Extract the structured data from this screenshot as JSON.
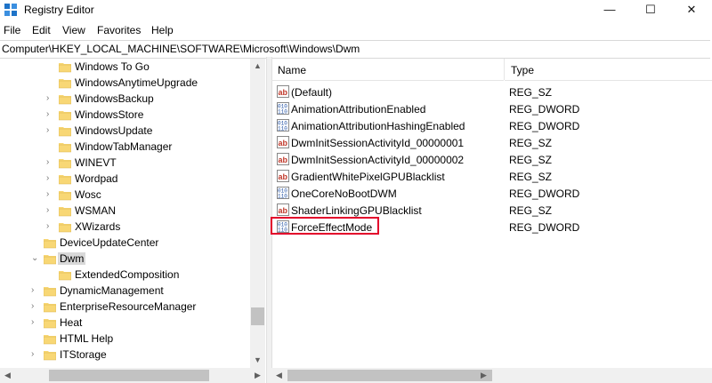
{
  "window": {
    "title": "Registry Editor",
    "minimize_glyph": "—",
    "maximize_glyph": "☐",
    "close_glyph": "✕"
  },
  "menu": [
    "File",
    "Edit",
    "View",
    "Favorites",
    "Help"
  ],
  "address": "Computer\\HKEY_LOCAL_MACHINE\\SOFTWARE\\Microsoft\\Windows\\Dwm",
  "tree": [
    {
      "label": "Windows To Go",
      "expander": false
    },
    {
      "label": "WindowsAnytimeUpgrade",
      "expander": false
    },
    {
      "label": "WindowsBackup",
      "expander": true
    },
    {
      "label": "WindowsStore",
      "expander": true
    },
    {
      "label": "WindowsUpdate",
      "expander": true
    },
    {
      "label": "WindowTabManager",
      "expander": false
    },
    {
      "label": "WINEVT",
      "expander": true
    },
    {
      "label": "Wordpad",
      "expander": true
    },
    {
      "label": "Wosc",
      "expander": true
    },
    {
      "label": "WSMAN",
      "expander": true
    },
    {
      "label": "XWizards",
      "expander": true
    },
    {
      "label": "DeviceUpdateCenter",
      "expander": false
    },
    {
      "label": "Dwm",
      "expander": true,
      "expanded": true,
      "selected": true
    },
    {
      "label": "ExtendedComposition",
      "expander": false
    },
    {
      "label": "DynamicManagement",
      "expander": true
    },
    {
      "label": "EnterpriseResourceManager",
      "expander": true
    },
    {
      "label": "Heat",
      "expander": true
    },
    {
      "label": "HTML Help",
      "expander": false
    },
    {
      "label": "ITStorage",
      "expander": true
    }
  ],
  "columns": {
    "name": "Name",
    "type": "Type"
  },
  "values": [
    {
      "name": "(Default)",
      "type": "REG_SZ",
      "icon": "string-value-icon"
    },
    {
      "name": "AnimationAttributionEnabled",
      "type": "REG_DWORD",
      "icon": "binary-value-icon"
    },
    {
      "name": "AnimationAttributionHashingEnabled",
      "type": "REG_DWORD",
      "icon": "binary-value-icon"
    },
    {
      "name": "DwmInitSessionActivityId_00000001",
      "type": "REG_SZ",
      "icon": "string-value-icon"
    },
    {
      "name": "DwmInitSessionActivityId_00000002",
      "type": "REG_SZ",
      "icon": "string-value-icon"
    },
    {
      "name": "GradientWhitePixelGPUBlacklist",
      "type": "REG_SZ",
      "icon": "string-value-icon"
    },
    {
      "name": "OneCoreNoBootDWM",
      "type": "REG_DWORD",
      "icon": "binary-value-icon"
    },
    {
      "name": "ShaderLinkingGPUBlacklist",
      "type": "REG_SZ",
      "icon": "string-value-icon"
    },
    {
      "name": "ForceEffectMode",
      "type": "REG_DWORD",
      "icon": "binary-value-icon"
    }
  ],
  "colors": {
    "highlight_border": "#e3002b",
    "folder": "#f8d775",
    "selected_bg": "#d9d9d9"
  }
}
